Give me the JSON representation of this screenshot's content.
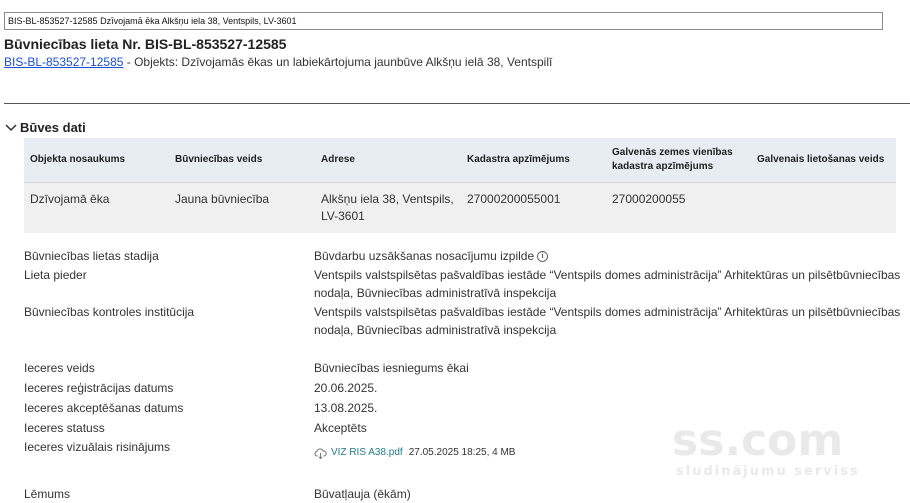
{
  "url": "BIS-BL-853527-12585 Dzīvojamā ēka Alkšņu iela 38, Ventspils, LV-3601",
  "title": "Būvniecības lieta Nr. BIS-BL-853527-12585",
  "sub": {
    "link": "BIS-BL-853527-12585",
    "text": " - Objekts: Dzīvojamās ēkas un labiekārtojuma jaunbūve Alkšņu ielā 38, Ventspilī"
  },
  "section": {
    "title": "Būves dati"
  },
  "table": {
    "headers": [
      "Objekta nosaukums",
      "Būvniecības veids",
      "Adrese",
      "Kadastra apzīmējums",
      "Galvenās zemes vienības kadastra apzīmējums",
      "Galvenais lietošanas veids"
    ],
    "row": [
      "Dzīvojamā ēka",
      "Jauna būvniecība",
      "Alkšņu iela 38, Ventspils, LV-3601",
      "27000200055001",
      "27000200055",
      ""
    ]
  },
  "details": {
    "stage_label": "Būvniecības lietas stadija",
    "stage_value": "Būvdarbu uzsākšanas nosacījumu izpilde",
    "owner_label": "Lieta pieder",
    "owner_value": "Ventspils valstspilsētas pašvaldības iestāde “Ventspils domes administrācija” Arhitektūras un pilsētbūvniecības nodaļa, Būvniecības administratīvā inspekcija",
    "control_label": "Būvniecības kontroles institūcija",
    "control_value": "Ventspils valstspilsētas pašvaldības iestāde “Ventspils domes administrācija” Arhitektūras un pilsētbūvniecības nodaļa, Būvniecības administratīvā inspekcija",
    "type_label": "Ieceres veids",
    "type_value": "Būvniecības iesniegums ēkai",
    "reg_label": "Ieceres reģistrācijas datums",
    "reg_value": "20.06.2025.",
    "acc_label": "Ieceres akceptēšanas datums",
    "acc_value": "13.08.2025.",
    "status_label": "Ieceres statuss",
    "status_value": "Akceptēts",
    "visual_label": "Ieceres vizuālais risinājums",
    "file_name": "VIZ RIS A38.pdf",
    "file_meta": "27.05.2025 18:25, 4 MB",
    "decision_label": "Lēmums",
    "decision_value": "Būvatļauja (ēkām)"
  },
  "watermark": {
    "brand": "ss.com",
    "tagline": "sludinājumu serviss"
  },
  "colors": {
    "link": "#1a4fd6",
    "file_link": "#1f7a8c",
    "table_header_bg": "#e8edf3",
    "table_row_bg": "#f0f0f0"
  },
  "icons": {
    "section_toggle": "chevron-down-icon",
    "stage_info": "info-icon",
    "file": "cloud-download-icon"
  }
}
